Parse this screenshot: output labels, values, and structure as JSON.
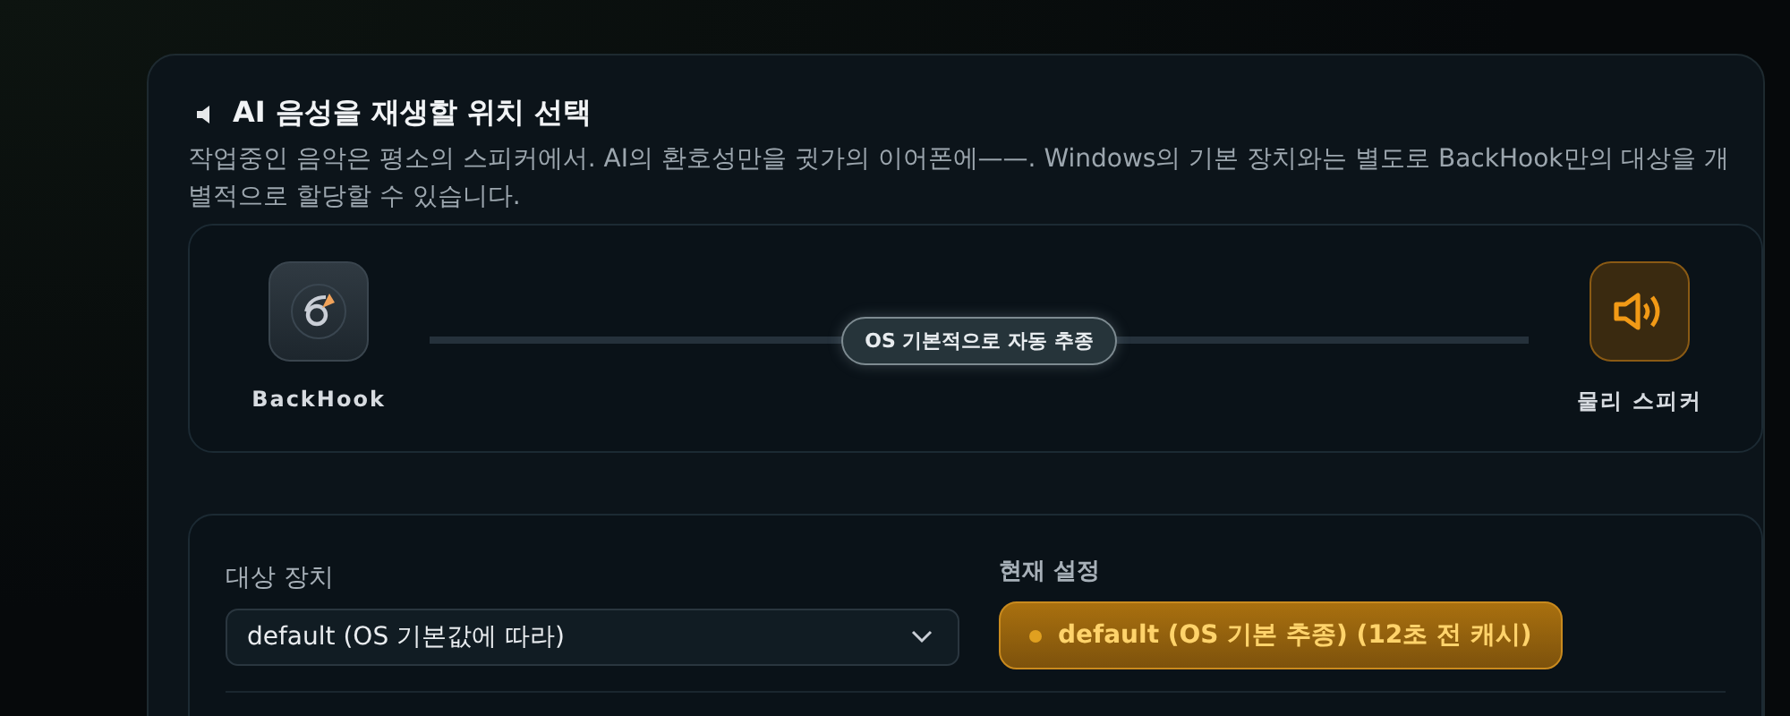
{
  "section": {
    "title": "AI 음성을 재생할 위치 선택",
    "description": "작업중인 음악은 평소의 스피커에서. AI의 환호성만을 귓가의 이어폰에——. Windows의 기본 장치와는 별도로 BackHook만의 대상을 개별적으로 할당할 수 있습니다."
  },
  "route": {
    "source": {
      "label": "BackHook"
    },
    "badge": "OS 기본적으로 자동 추종",
    "target": {
      "label": "물리 스피커"
    }
  },
  "device": {
    "label": "대상 장치",
    "value": "default (OS 기본값에 따라)"
  },
  "current": {
    "label": "현재 설정",
    "value": "default (OS 기본 추종) (12초 전 캐시)"
  }
}
